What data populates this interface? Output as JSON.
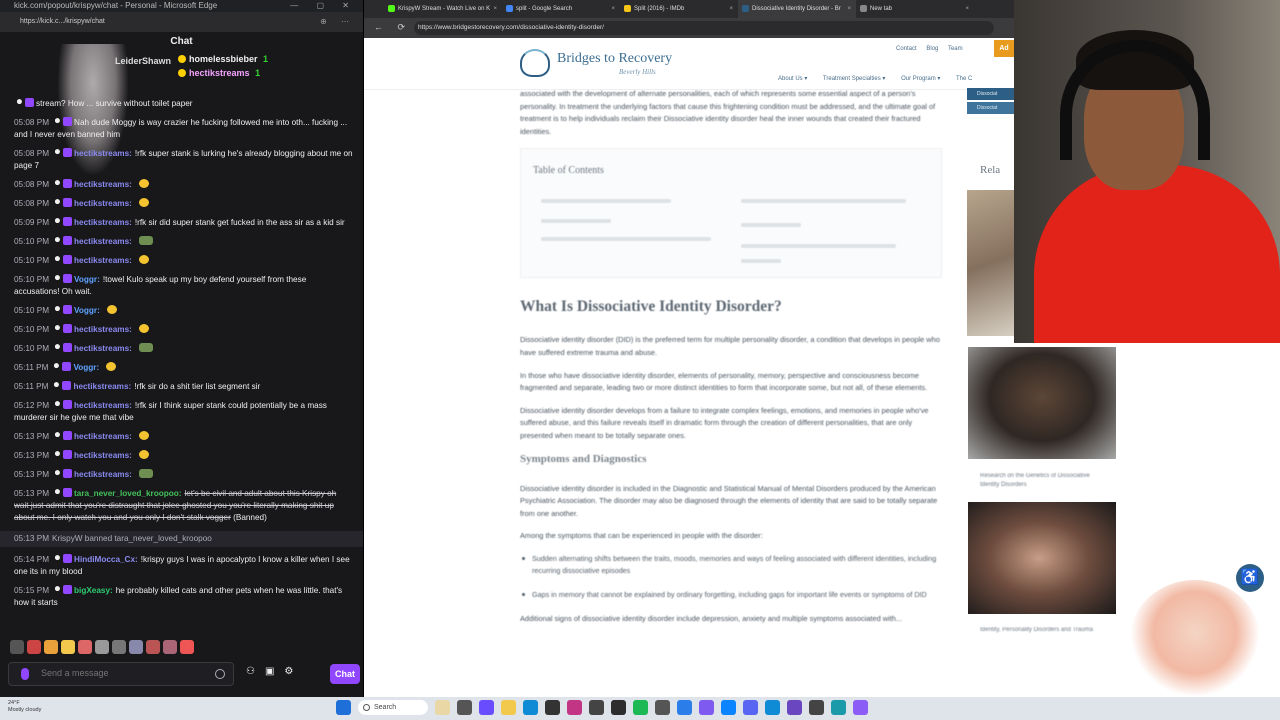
{
  "chat_window": {
    "title": "kick.com/popout/krispyw/chat - Personal - Microsoft Edge",
    "url": "https://kick.c.../krispyw/chat",
    "header": "Chat",
    "pinned": {
      "gifter_left": "LeiderShawn",
      "gifter_1": "homelessbieber",
      "gifter_1_count": "1",
      "gifter_2": "hectikstreams",
      "gifter_2_count": "1"
    },
    "messages": [
      {
        "time": "",
        "user": "",
        "text": "stream? How ... survive without toilet paper",
        "ucls": "u-hectik"
      },
      {
        "time": "05:08 PM",
        "user": "",
        "text": "Nah dude Moggy is way crazier he fucking followed me into oth... fucking ... and I never even banned him",
        "ucls": "u-voggr"
      },
      {
        "time": "05:08 PM",
        "user": "hectikstreams:",
        "text": "!rfk super stank is lurking he's already blogging about me on page 7",
        "ucls": "u-hectik"
      },
      {
        "time": "05:08 PM",
        "user": "hectikstreams:",
        "text": "",
        "emote": "e-yellow",
        "ucls": "u-hectik"
      },
      {
        "time": "05:08 PM",
        "user": "hectikstreams:",
        "text": "",
        "emote": "e-yellow",
        "ucls": "u-hectik"
      },
      {
        "time": "05:09 PM",
        "user": "hectikstreams:",
        "text": "!rfk sir did super stank get fucked in the ass sir as a kid sir",
        "ucls": "u-hectik"
      },
      {
        "time": "05:10 PM",
        "user": "hectikstreams:",
        "text": "",
        "emote": "e-green",
        "ucls": "u-hectik"
      },
      {
        "time": "05:10 PM",
        "user": "hectikstreams:",
        "text": "",
        "emote": "e-yellow",
        "ucls": "u-hectik"
      },
      {
        "time": "05:10 PM",
        "user": "Voggr:",
        "text": "!towel Kulo speak up my boy defend yourself from these accusations! Oh wait.",
        "ucls": "u-voggr"
      },
      {
        "time": "05:10 PM",
        "user": "Voggr:",
        "text": "",
        "emote": "e-yellow",
        "ucls": "u-voggr"
      },
      {
        "time": "05:10 PM",
        "user": "hectikstreams:",
        "text": "",
        "emote": "e-yellow",
        "ucls": "u-hectik"
      },
      {
        "time": "05:10 PM",
        "user": "hectikstreams:",
        "text": "",
        "emote": "e-green",
        "ucls": "u-hectik"
      },
      {
        "time": "05:11 PM",
        "user": "Voggr:",
        "text": "",
        "emote": "e-yellow",
        "ucls": "u-voggr"
      },
      {
        "time": "05:11 PM",
        "user": "hectikstreams:",
        "text": "!rfk sir do a shit tier list segment sir",
        "ucls": "u-hectik"
      },
      {
        "time": "05:12 PM",
        "user": "hectikstreams:",
        "text": "!rfk sir I think super stank could potentially be a mass murderer sir he give me that vibe",
        "ucls": "u-hectik"
      },
      {
        "time": "05:13 PM",
        "user": "hectikstreams:",
        "text": "",
        "emote": "e-yellow",
        "ucls": "u-hectik"
      },
      {
        "time": "05:13 PM",
        "user": "hectikstreams:",
        "text": "",
        "emote": "e-yellow",
        "ucls": "u-hectik"
      },
      {
        "time": "05:13 PM",
        "user": "hectikstreams:",
        "text": "",
        "emote": "e-green",
        "ucls": "u-hectik"
      },
      {
        "time": "05:13 PM",
        "user": "tara_never_loved_kroopoo:",
        "text": "let's be civil and adult about this Krispy oh wait just admit that you're distraught that jolee ghosted you you're literally making shit up about me. I only watch you and you only I don't stalk vogger",
        "suffix": "(Banned)",
        "ucls": "u-tara",
        "struck": true
      },
      {
        "time": "05:13 PM",
        "user": "",
        "text": "KrispyW banned tara_never_loved_kroopoo",
        "ucls": "u-tara",
        "sys": true
      },
      {
        "time": "05:14 PM",
        "user": "HindiMocca_Cx:",
        "text": "!krispy guys I was in apocalypto I know a killer when I see one its in my blood",
        "ucls": "u-hindi"
      },
      {
        "time": "05:15 PM",
        "user": "bigXeasy:",
        "text": "he probably killed cats and other pets when he was little. that's how it starts",
        "ucls": "u-big"
      }
    ],
    "input_placeholder": "Send a message",
    "chat_button": "Chat"
  },
  "browser": {
    "tabs": [
      {
        "label": "KrispyW Stream - Watch Live on K",
        "color": "#53fc18"
      },
      {
        "label": "split - Google Search",
        "color": "#4285f4"
      },
      {
        "label": "Split (2016) - IMDb",
        "color": "#f5c518"
      },
      {
        "label": "Dissociative Identity Disorder - Br",
        "color": "#2d5f86",
        "active": true
      },
      {
        "label": "New tab",
        "color": "#888888"
      }
    ],
    "url": "https://www.bridgestorecovery.com/dissociative-identity-disorder/",
    "site": {
      "logo": "Bridges to Recovery",
      "logo_sub": "Beverly Hills",
      "top_links": [
        "Contact",
        "Blog",
        "Team"
      ],
      "cta": "Ad",
      "nav": [
        "About Us ▾",
        "Treatment Specialties ▾",
        "Our Program ▾",
        "The C"
      ]
    },
    "article": {
      "intro": "associated with the development of alternate personalities, each of which represents some essential aspect of a person's personality. In treatment the underlying factors that cause this frightening condition must be addressed, and the ultimate goal of treatment is to help individuals reclaim their Dissociative identity disorder heal the inner wounds that created their fractured identities.",
      "toc_title": "Table of Contents",
      "h2": "What Is Dissociative Identity Disorder?",
      "p1": "Dissociative identity disorder (DID) is the preferred term for multiple personality disorder, a condition that develops in people who have suffered extreme trauma and abuse.",
      "p2": "In those who have dissociative identity disorder, elements of personality, memory, perspective and consciousness become fragmented and separate, leading two or more distinct identities to form that incorporate some, but not all, of these elements.",
      "p3": "Dissociative identity disorder develops from a failure to integrate complex feelings, emotions, and memories in people who've suffered abuse, and this failure reveals itself in dramatic form through the creation of different personalities, that are only presented when meant to be totally separate ones.",
      "h3": "Symptoms and Diagnostics",
      "p4": "Dissociative identity disorder is included in the Diagnostic and Statistical Manual of Mental Disorders produced by the American Psychiatric Association. The disorder may also be diagnosed through the elements of identity that are said to be totally separate from one another.",
      "p5": "Among the symptoms that can be experienced in people with the disorder:",
      "bullets": [
        "Sudden alternating shifts between the traits, moods, memories and ways of feeling associated with different identities, including recurring dissociative episodes",
        "Gaps in memory that cannot be explained by ordinary forgetting, including gaps for important life events or symptoms of DID"
      ],
      "p6": "Additional signs of dissociative identity disorder include depression, anxiety and multiple symptoms associated with..."
    },
    "sidebar_tabs": [
      "Dissociat",
      "Dissociat"
    ],
    "related_heading": "Rela",
    "related_caption_1": "Research on the Genetics of Dissociative Identity Disorders",
    "related_caption_2": "Identity, Personality Disorders and Trauma",
    "accessibility_icon": "♿"
  },
  "taskbar": {
    "weather_temp": "24°F",
    "weather_desc": "Mostly cloudy",
    "search": "Search"
  }
}
